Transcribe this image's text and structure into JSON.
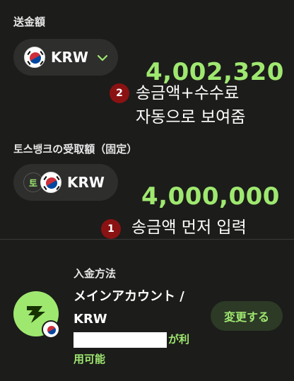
{
  "send": {
    "label": "送金額",
    "currency": "KRW",
    "amount": "4,002,320",
    "note_number": "2",
    "note_line1": "송금액+수수료",
    "note_line2": "자동으로 보여줌"
  },
  "receive": {
    "label": "토스뱅크の受取額（固定）",
    "bank_badge": "토",
    "currency": "KRW",
    "amount": "4,000,000",
    "note_number": "1",
    "note_text": "송금액 먼저 입력"
  },
  "payment": {
    "title": "入金方法",
    "method_line1": "メインアカウント /",
    "method_line2": "KRW",
    "available_suffix": "が利",
    "available_line2": "用可能",
    "change_label": "変更する"
  },
  "colors": {
    "accent": "#9fe870",
    "background": "#1c1c1b",
    "annotation_badge": "#8b1212"
  },
  "icons": [
    "korea-flag-icon",
    "chevron-down-icon",
    "wise-logo-icon",
    "toss-bank-icon"
  ]
}
